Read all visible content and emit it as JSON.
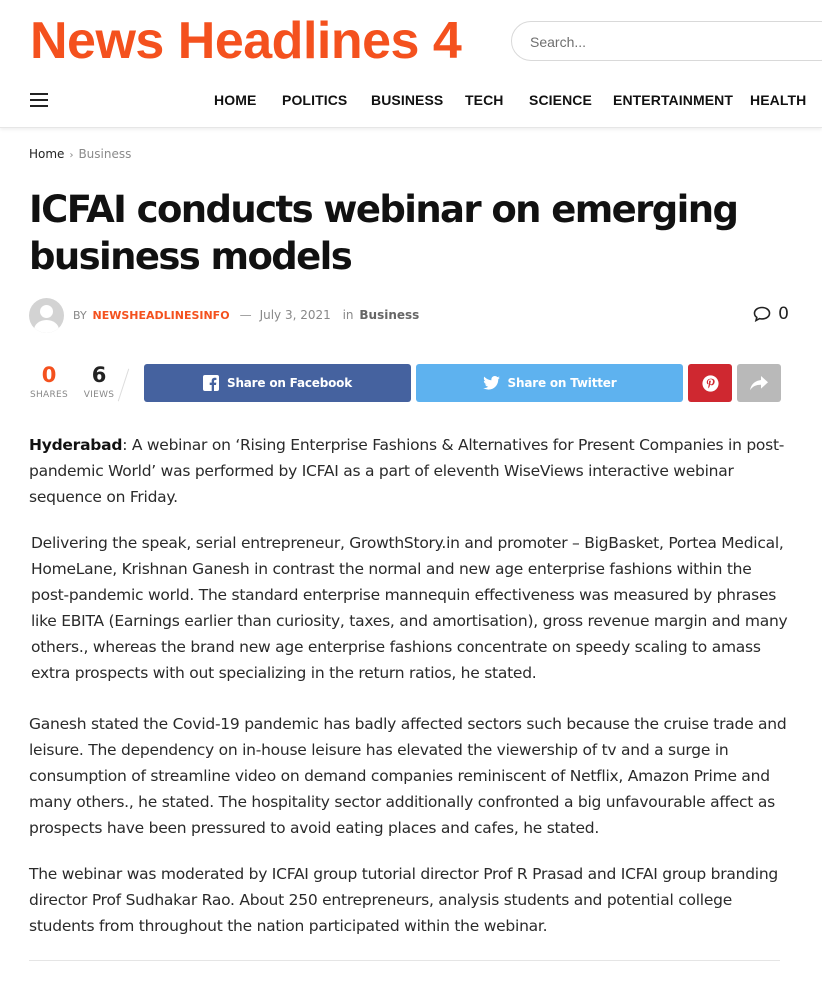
{
  "site": {
    "logo": "News Headlines 4",
    "search_placeholder": "Search..."
  },
  "nav": {
    "items": [
      "HOME",
      "POLITICS",
      "BUSINESS",
      "TECH",
      "SCIENCE",
      "ENTERTAINMENT",
      "HEALTH"
    ]
  },
  "breadcrumb": {
    "home": "Home",
    "separator": "›",
    "current": "Business"
  },
  "article": {
    "title": "ICFAI conducts webinar on emerging business models",
    "meta": {
      "by": "BY",
      "author": "NEWSHEADLINESINFO",
      "dash": "—",
      "date": "July 3, 2021",
      "in": "in",
      "category": "Business",
      "comments": "0"
    },
    "share": {
      "shares_count": "0",
      "shares_label": "SHARES",
      "views_count": "6",
      "views_label": "VIEWS",
      "facebook_label": "Share on Facebook",
      "twitter_label": "Share on Twitter"
    },
    "p1_lead": "Hyderabad",
    "p1_rest": ": A webinar on ‘Rising Enterprise Fashions & Alternatives for Present Companies in post-pandemic World’ was performed by ICFAI as a part of eleventh WiseViews interactive webinar sequence on Friday.",
    "p2": "Delivering the speak, serial entrepreneur, GrowthStory.in and promoter – BigBasket, Portea Medical, HomeLane, Krishnan Ganesh in contrast the normal and new age enterprise fashions within the post-pandemic world. The standard enterprise mannequin effectiveness was measured by phrases like EBITA (Earnings earlier than curiosity, taxes, and amortisation), gross revenue margin and many others., whereas the brand new age enterprise fashions concentrate on speedy scaling to amass extra prospects with out specializing in the return ratios, he stated.",
    "p3": "Ganesh stated the Covid-19 pandemic has badly affected sectors such because the cruise trade and leisure. The dependency on in-house leisure has elevated the viewership of tv and a surge in consumption of streamline video on demand companies reminiscent of Netflix, Amazon Prime and many others., he stated. The hospitality sector additionally confronted a big unfavourable affect as prospects have been pressured to avoid eating places and cafes, he stated.",
    "p4": "The webinar was moderated by ICFAI group tutorial director Prof R Prasad and ICFAI group branding director Prof Sudhakar Rao. About 250 entrepreneurs, analysis students and potential college students from throughout the nation participated within the webinar."
  },
  "colors": {
    "brand": "#f4511e",
    "facebook": "#45629f",
    "twitter": "#5eb2ef",
    "pinterest": "#cf2830",
    "more": "#b9b9b9"
  },
  "icons": {
    "menu": "hamburger-icon",
    "comments": "comment-bubble-icon",
    "facebook": "facebook-icon",
    "twitter": "twitter-bird-icon",
    "pinterest": "pinterest-icon",
    "share_more": "share-arrow-icon"
  }
}
